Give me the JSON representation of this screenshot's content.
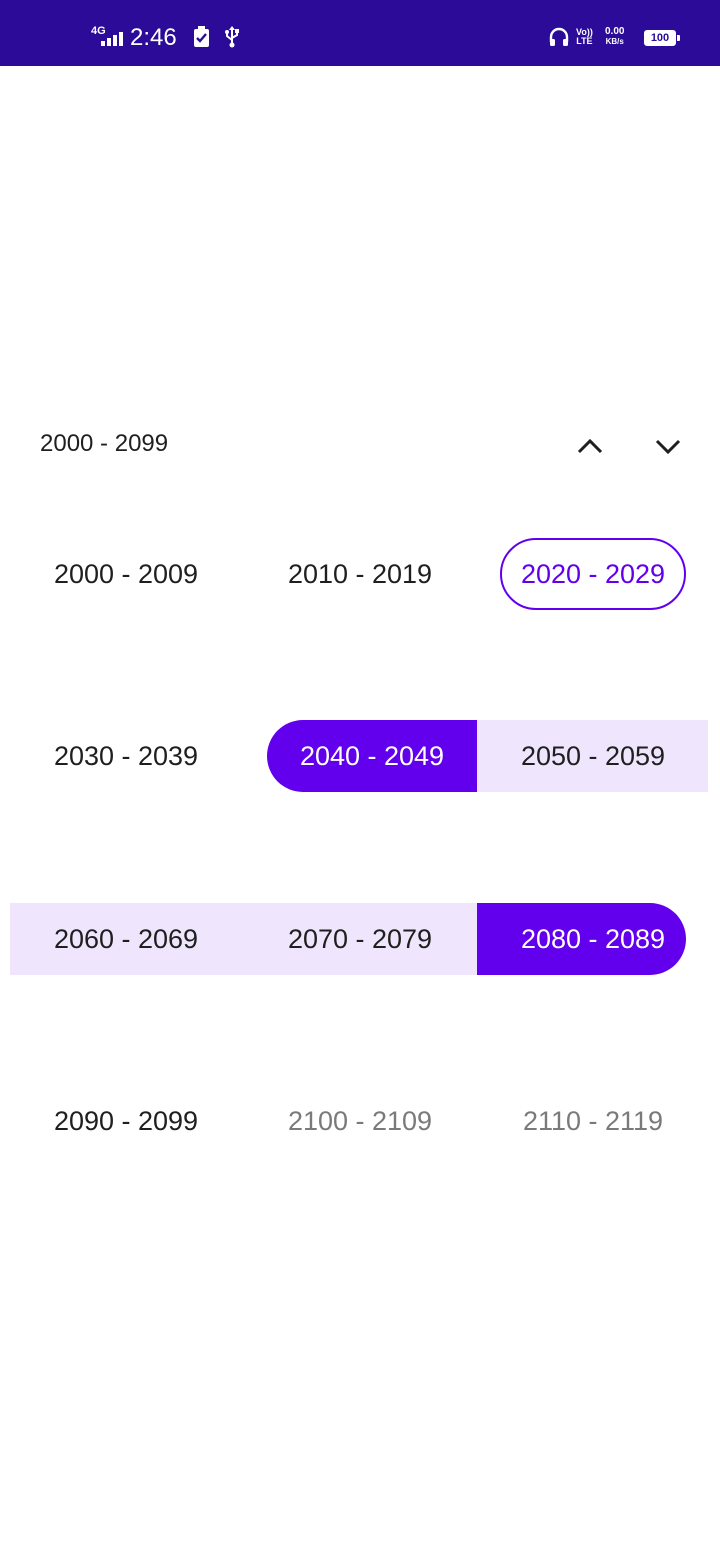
{
  "status_bar": {
    "network": "4G",
    "time": "2:46",
    "volte_top": "Vo))",
    "volte_bottom": "LTE",
    "speed_value": "0.00",
    "speed_unit": "KB/s",
    "battery": "100",
    "icons": [
      "signal-icon",
      "battery-saver-icon",
      "usb-icon",
      "headphones-icon"
    ]
  },
  "picker": {
    "header_range": "2000 - 2099",
    "prev_icon": "chevron-up-icon",
    "next_icon": "chevron-down-icon",
    "accent_color": "#6200ee",
    "range_highlight_color": "#efe6fd",
    "decades": [
      {
        "label": "2000 - 2009",
        "state": "normal"
      },
      {
        "label": "2010 - 2019",
        "state": "normal"
      },
      {
        "label": "2020 - 2029",
        "state": "current"
      },
      {
        "label": "2030 - 2039",
        "state": "normal"
      },
      {
        "label": "2040 - 2049",
        "state": "range-start"
      },
      {
        "label": "2050 - 2059",
        "state": "in-range"
      },
      {
        "label": "2060 - 2069",
        "state": "in-range"
      },
      {
        "label": "2070 - 2079",
        "state": "in-range"
      },
      {
        "label": "2080 - 2089",
        "state": "range-end"
      },
      {
        "label": "2090 - 2099",
        "state": "normal"
      },
      {
        "label": "2100 - 2109",
        "state": "out-of-range"
      },
      {
        "label": "2110 - 2119",
        "state": "out-of-range"
      }
    ]
  }
}
